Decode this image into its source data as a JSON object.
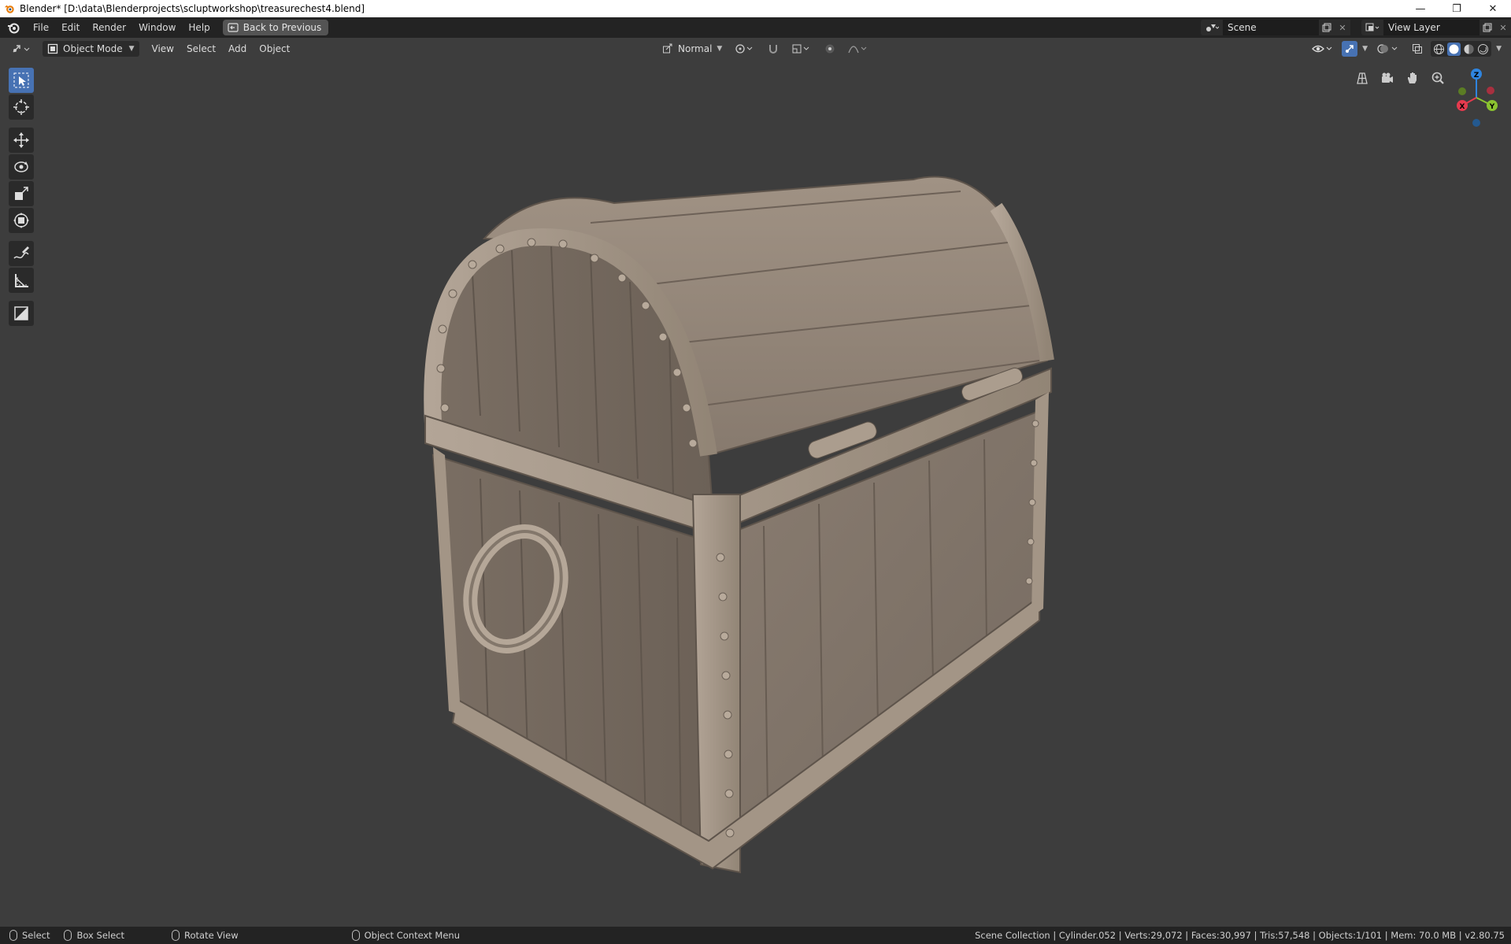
{
  "window": {
    "title": "Blender* [D:\\data\\Blenderprojects\\scluptworkshop\\treasurechest4.blend]",
    "minimize": "—",
    "maximize": "❐",
    "close": "✕"
  },
  "topbar": {
    "menu": [
      "File",
      "Edit",
      "Render",
      "Window",
      "Help"
    ],
    "back_button": "Back to Previous",
    "scene_name": "Scene",
    "view_layer": "View Layer"
  },
  "viewport_header": {
    "mode": "Object Mode",
    "menu": [
      "View",
      "Select",
      "Add",
      "Object"
    ],
    "orientation": "Normal"
  },
  "toolbar": {
    "tools": [
      "select-box",
      "cursor",
      "move",
      "rotate",
      "scale",
      "transform",
      "annotate",
      "measure",
      "add-cube"
    ],
    "active": "select-box"
  },
  "gizmo": {
    "x": "X",
    "y": "Y",
    "z": "Z"
  },
  "statusbar": {
    "select": "Select",
    "box_select": "Box Select",
    "rotate_view": "Rotate View",
    "context_menu": "Object Context Menu",
    "stats": "Scene Collection | Cylinder.052 | Verts:29,072 | Faces:30,997 | Tris:57,548 | Objects:1/101 | Mem: 70.0 MB | v2.80.75"
  },
  "colors": {
    "accent": "#4772b3",
    "axis_x": "#e53a4e",
    "axis_y": "#8bc430",
    "axis_z": "#2f85e0",
    "model": "#8d8074"
  }
}
